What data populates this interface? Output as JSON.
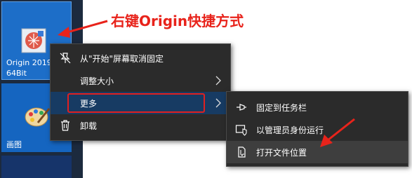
{
  "annotation": {
    "text": "右键Origin快捷方式",
    "color": "#e8231b"
  },
  "tiles": {
    "origin": {
      "label_line1": "Origin 2019",
      "label_line2": "64Bit",
      "icon": "origin-app-icon"
    },
    "paint": {
      "label": "画图",
      "icon": "paint-palette-icon"
    }
  },
  "context_menu": {
    "items": [
      {
        "label": "从\"开始\"屏幕取消固定",
        "icon": "unpin-icon"
      },
      {
        "label": "调整大小",
        "icon": "",
        "has_submenu": true
      },
      {
        "label": "更多",
        "icon": "",
        "has_submenu": true,
        "selected": true
      },
      {
        "label": "卸载",
        "icon": "trash-icon"
      }
    ]
  },
  "submenu": {
    "items": [
      {
        "label": "固定到任务栏",
        "icon": "pin-icon"
      },
      {
        "label": "以管理员身份运行",
        "icon": "admin-shield-icon"
      },
      {
        "label": "打开文件位置",
        "icon": "file-location-icon",
        "highlighted": true
      }
    ]
  },
  "colors": {
    "menu_bg": "#2b2b2b",
    "selected_bg": "#173b63",
    "highlight": "#e02020",
    "tile_blue": "#1565c0"
  }
}
